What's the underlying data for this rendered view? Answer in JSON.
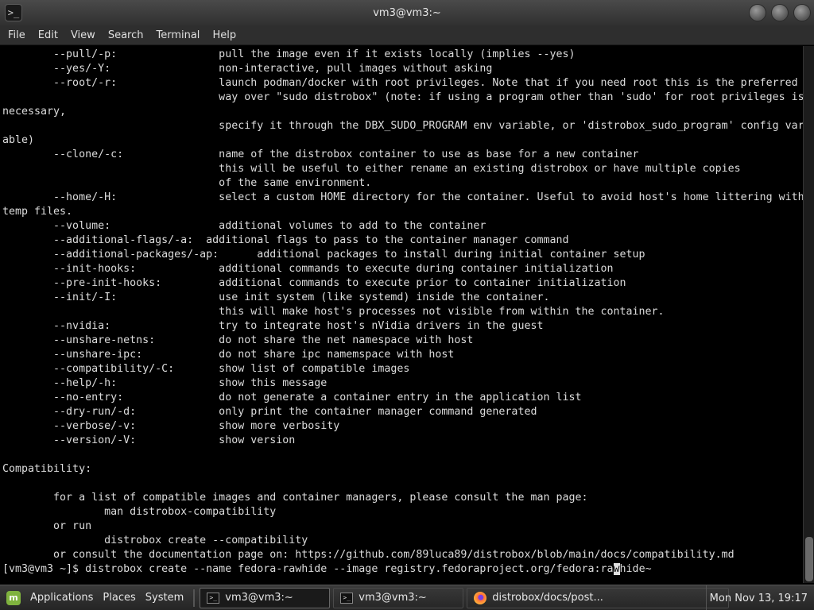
{
  "window": {
    "title": "vm3@vm3:~",
    "icon_glyph": ">_"
  },
  "menubar": {
    "items": [
      "File",
      "Edit",
      "View",
      "Search",
      "Terminal",
      "Help"
    ]
  },
  "terminal": {
    "lines": [
      "        --pull/-p:                pull the image even if it exists locally (implies --yes)",
      "        --yes/-Y:                 non-interactive, pull images without asking",
      "        --root/-r:                launch podman/docker with root privileges. Note that if you need root this is the preferred",
      "                                  way over \"sudo distrobox\" (note: if using a program other than 'sudo' for root privileges is",
      "necessary,",
      "                                  specify it through the DBX_SUDO_PROGRAM env variable, or 'distrobox_sudo_program' config vari",
      "able)",
      "        --clone/-c:               name of the distrobox container to use as base for a new container",
      "                                  this will be useful to either rename an existing distrobox or have multiple copies",
      "                                  of the same environment.",
      "        --home/-H:                select a custom HOME directory for the container. Useful to avoid host's home littering with",
      "temp files.",
      "        --volume:                 additional volumes to add to the container",
      "        --additional-flags/-a:  additional flags to pass to the container manager command",
      "        --additional-packages/-ap:      additional packages to install during initial container setup",
      "        --init-hooks:             additional commands to execute during container initialization",
      "        --pre-init-hooks:         additional commands to execute prior to container initialization",
      "        --init/-I:                use init system (like systemd) inside the container.",
      "                                  this will make host's processes not visible from within the container.",
      "        --nvidia:                 try to integrate host's nVidia drivers in the guest",
      "        --unshare-netns:          do not share the net namespace with host",
      "        --unshare-ipc:            do not share ipc namemspace with host",
      "        --compatibility/-C:       show list of compatible images",
      "        --help/-h:                show this message",
      "        --no-entry:               do not generate a container entry in the application list",
      "        --dry-run/-d:             only print the container manager command generated",
      "        --verbose/-v:             show more verbosity",
      "        --version/-V:             show version",
      "",
      "Compatibility:",
      "",
      "        for a list of compatible images and container managers, please consult the man page:",
      "                man distrobox-compatibility",
      "        or run",
      "                distrobox create --compatibility",
      "        or consult the documentation page on: https://github.com/89luca89/distrobox/blob/main/docs/compatibility.md"
    ],
    "prompt_before_cursor": "[vm3@vm3 ~]$ distrobox create --name fedora-rawhide --image registry.fedoraproject.org/fedora:ra",
    "prompt_cursor_char": "w",
    "prompt_after_cursor": "hide~"
  },
  "taskbar": {
    "menus": [
      "Applications",
      "Places",
      "System"
    ],
    "tasks": [
      {
        "label": "vm3@vm3:~",
        "icon": "terminal-icon",
        "active": true
      },
      {
        "label": "vm3@vm3:~",
        "icon": "terminal-icon",
        "active": false
      },
      {
        "label": "distrobox/docs/post...",
        "icon": "firefox-icon",
        "active": false
      }
    ],
    "clock": "Mon Nov 13, 19:17"
  }
}
